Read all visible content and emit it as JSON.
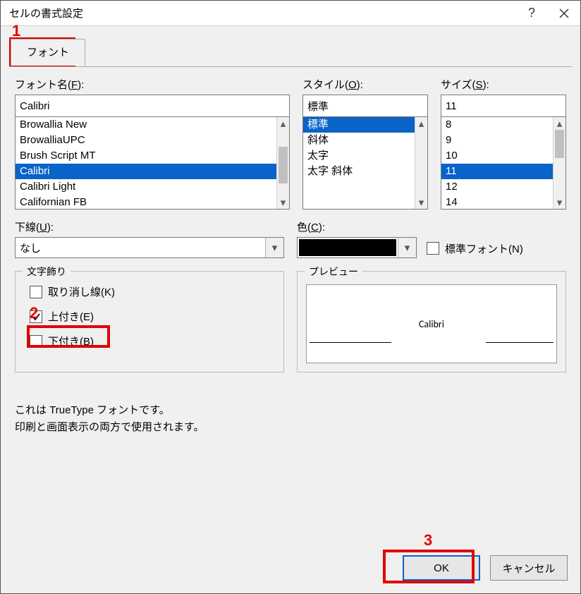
{
  "dialog": {
    "title": "セルの書式設定"
  },
  "titlebar": {
    "help_icon": "?",
    "close_icon": "close-icon"
  },
  "tabs": {
    "font": "フォント"
  },
  "font_name": {
    "label_prefix": "フォント名(",
    "label_key": "F",
    "label_suffix": "):",
    "value": "Calibri",
    "items": [
      "Browallia New",
      "BrowalliaUPC",
      "Brush Script MT",
      "Calibri",
      "Calibri Light",
      "Californian FB"
    ],
    "selected_index": 3
  },
  "style": {
    "label_prefix": "スタイル(",
    "label_key": "O",
    "label_suffix": "):",
    "value": "標準",
    "items": [
      "標準",
      "斜体",
      "太字",
      "太字 斜体"
    ],
    "selected_index": 0
  },
  "size": {
    "label_prefix": "サイズ(",
    "label_key": "S",
    "label_suffix": "):",
    "value": "11",
    "items": [
      "8",
      "9",
      "10",
      "11",
      "12",
      "14"
    ],
    "selected_index": 3
  },
  "underline": {
    "label_prefix": "下線(",
    "label_key": "U",
    "label_suffix": "):",
    "value": "なし"
  },
  "color": {
    "label_prefix": "色(",
    "label_key": "C",
    "label_suffix": "):",
    "swatch": "#000000"
  },
  "normal_font": {
    "label_prefix": "標準フォント(",
    "label_key": "N",
    "label_suffix": ")",
    "checked": false
  },
  "effects": {
    "legend": "文字飾り",
    "strike": {
      "label_prefix": "取り消し線(",
      "label_key": "K",
      "label_suffix": ")",
      "checked": false
    },
    "super": {
      "label_prefix": "上付き(",
      "label_key": "E",
      "label_suffix": ")",
      "checked": true
    },
    "sub": {
      "label_prefix": "下付き(",
      "label_key": "B",
      "label_suffix": ")",
      "checked": false
    }
  },
  "preview": {
    "legend": "プレビュー",
    "text": "Calibri"
  },
  "note": {
    "line1": "これは TrueType フォントです。",
    "line2": "印刷と画面表示の両方で使用されます。"
  },
  "buttons": {
    "ok": "OK",
    "cancel": "キャンセル"
  },
  "annotations": {
    "n1": "1",
    "n2": "2",
    "n3": "3"
  }
}
